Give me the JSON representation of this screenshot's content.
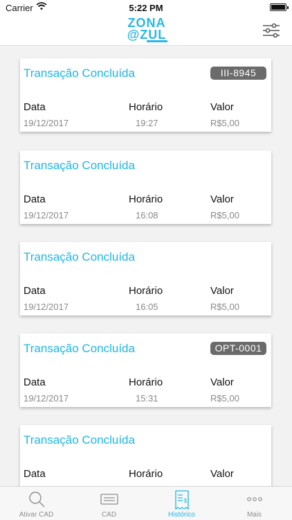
{
  "status_bar": {
    "carrier": "Carrier",
    "time": "5:22 PM",
    "battery_level_percent": 100
  },
  "header": {
    "logo_line1": "ZONA",
    "logo_line2": "@ZUL",
    "menu_icon": "filter-sliders-icon"
  },
  "colors": {
    "accent": "#1fb6e4",
    "plate_bg": "#6b6b6b",
    "background": "#f2f2f2"
  },
  "columns": {
    "date": "Data",
    "time": "Horário",
    "value": "Valor"
  },
  "transactions": [
    {
      "status": "Transação Concluída",
      "plate": "III-8945",
      "date": "19/12/2017",
      "time": "19:27",
      "value": "R$5,00"
    },
    {
      "status": "Transação Concluída",
      "plate": "",
      "date": "19/12/2017",
      "time": "16:08",
      "value": "R$5,00"
    },
    {
      "status": "Transação Concluída",
      "plate": "",
      "date": "19/12/2017",
      "time": "16:05",
      "value": "R$5,00"
    },
    {
      "status": "Transação Concluída",
      "plate": "OPT-0001",
      "date": "19/12/2017",
      "time": "15:31",
      "value": "R$5,00"
    },
    {
      "status": "Transação Concluída",
      "plate": ""
    }
  ],
  "tabs": [
    {
      "label": "Ativar CAD",
      "icon": "search-icon",
      "active": false
    },
    {
      "label": "CAD",
      "icon": "ticket-icon",
      "active": false
    },
    {
      "label": "Histórico",
      "icon": "receipt-icon",
      "active": true
    },
    {
      "label": "Mais",
      "icon": "more-icon",
      "active": false
    }
  ]
}
